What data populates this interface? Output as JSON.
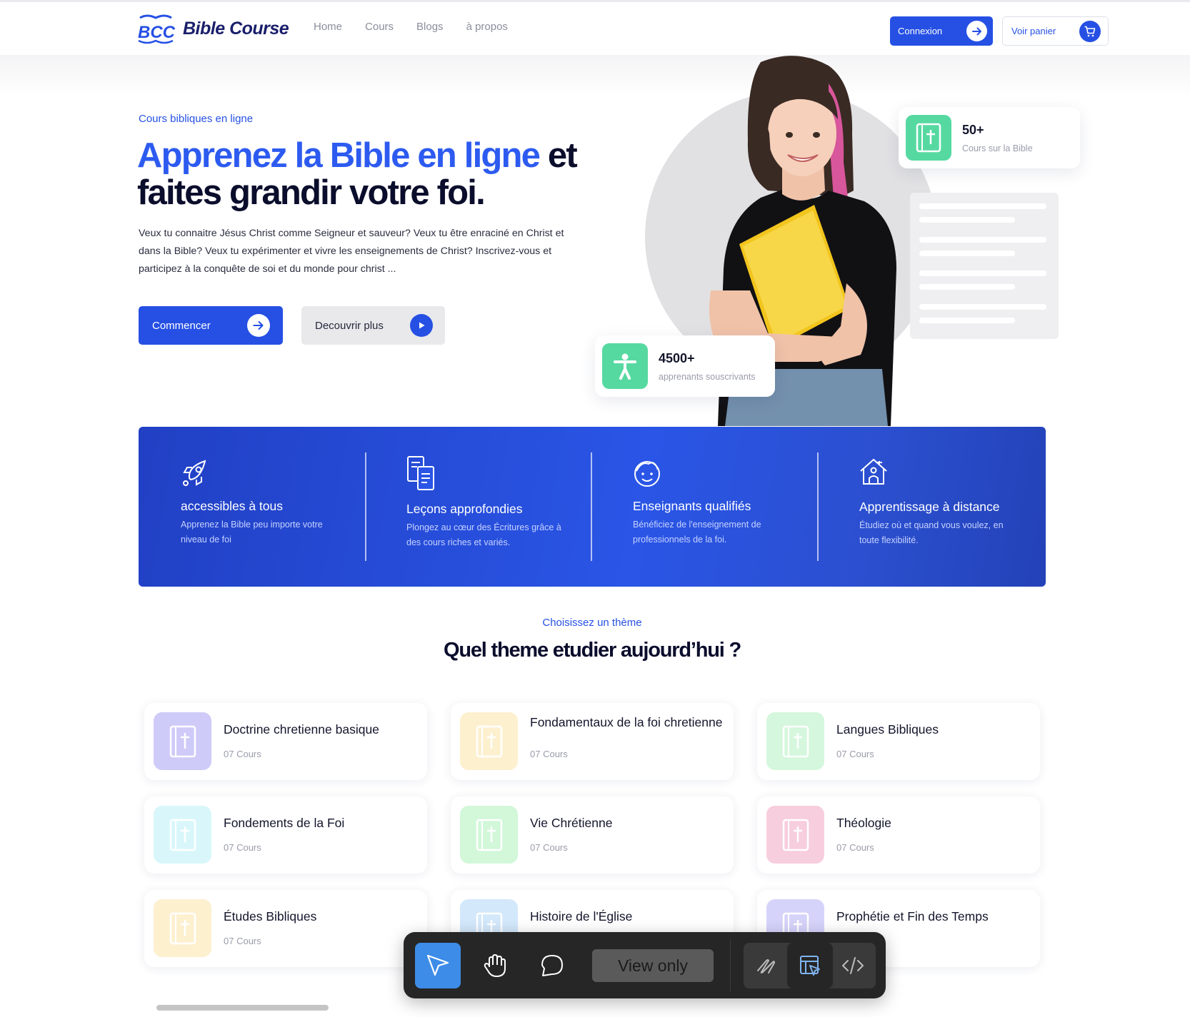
{
  "nav": {
    "logo_mark": "BCC",
    "logo_text": "Bible Course",
    "links": [
      "Home",
      "Cours",
      "Blogs",
      "à propos"
    ],
    "login_label": "Connexion",
    "cart_label": "Voir panier"
  },
  "hero": {
    "eyebrow": "Cours bibliques en ligne",
    "title_highlight": "Apprenez la Bible en ligne",
    "title_rest_1": " et",
    "title_rest_2": "faites grandir votre foi.",
    "lead": "Veux tu connaitre Jésus Christ comme Seigneur et sauveur? Veux tu être enraciné en Christ et dans la Bible? Veux tu expérimenter et vivre les enseignements de Christ?  Inscrivez-vous et participez à la conquête de soi et du monde pour christ ...",
    "start_label": "Commencer",
    "more_label": "Decouvrir plus",
    "stat_courses": {
      "value": "50+",
      "label": "Cours sur la Bible"
    },
    "stat_learners": {
      "value": "4500+",
      "label": "apprenants souscrivants"
    }
  },
  "features": [
    {
      "icon": "rocket-icon",
      "title": "accessibles à tous",
      "desc": "Apprenez la Bible peu importe votre niveau de foi"
    },
    {
      "icon": "documents-icon",
      "title": "Leçons approfondies",
      "desc": "Plongez au cœur des Écritures grâce à des cours riches et variés."
    },
    {
      "icon": "teacher-face-icon",
      "title": "Enseignants qualifiés",
      "desc": "Bénéficiez de l'enseignement de professionnels de la foi."
    },
    {
      "icon": "remote-home-icon",
      "title": "Apprentissage à distance",
      "desc": "Étudiez où et quand vous voulez, en toute flexibilité."
    }
  ],
  "themes_section": {
    "eyebrow": "Choisissez un thème",
    "title": "Quel theme etudier aujourd’hui ?",
    "cards": [
      {
        "name": "Doctrine chretienne basique",
        "count": "07 Cours",
        "color": "#cfcbf8",
        "icon_color": "#ffffff"
      },
      {
        "name": "Fondamentaux de la foi chretienne",
        "count": "07 Cours",
        "color": "#fdf0cf",
        "icon_color": "#ffffff"
      },
      {
        "name": "Langues Bibliques",
        "count": "07 Cours",
        "color": "#d5f7dd",
        "icon_color": "#ffffff"
      },
      {
        "name": "Fondements de la Foi",
        "count": "07 Cours",
        "color": "#d9f7fb",
        "icon_color": "#ffffff"
      },
      {
        "name": "Vie Chrétienne",
        "count": "07 Cours",
        "color": "#d2f7d9",
        "icon_color": "#ffffff"
      },
      {
        "name": "Théologie",
        "count": "07 Cours",
        "color": "#f7cede",
        "icon_color": "#ffffff"
      },
      {
        "name": "Études Bibliques",
        "count": "07 Cours",
        "color": "#fdf0cf",
        "icon_color": "#ffffff"
      },
      {
        "name": "Histoire de l'Église",
        "count": "",
        "color": "#d3e8fb",
        "icon_color": "#ffffff"
      },
      {
        "name": "Prophétie et Fin des Temps",
        "count": "",
        "color": "#d6d3fa",
        "icon_color": "#ffffff"
      }
    ]
  },
  "toolbar": {
    "tools": [
      "pointer-icon",
      "hand-icon",
      "comment-icon"
    ],
    "view_label": "View only",
    "right_tools": [
      "draw-icon",
      "inspect-icon",
      "code-icon"
    ]
  },
  "colors": {
    "brand": "#2650e4",
    "accent_green": "#56d9a1",
    "dark": "#0b0d2c"
  }
}
